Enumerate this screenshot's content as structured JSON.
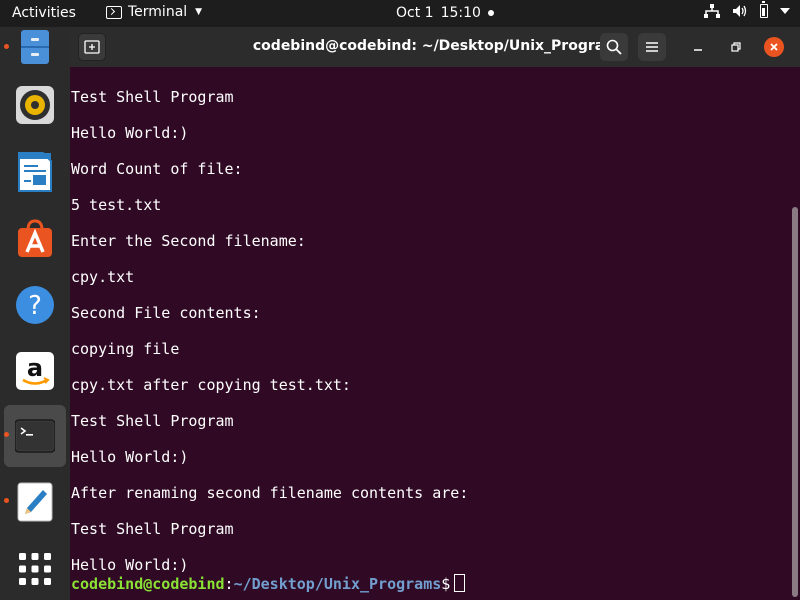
{
  "topbar": {
    "activities": "Activities",
    "app_name": "Terminal",
    "date": "Oct 1",
    "time": "15:10"
  },
  "dock": {
    "items": [
      {
        "name": "files",
        "icon": "file-cabinet-icon",
        "running": true
      },
      {
        "name": "rhythmbox",
        "icon": "speaker-icon",
        "running": false
      },
      {
        "name": "libreoffice-writer",
        "icon": "document-icon",
        "running": false
      },
      {
        "name": "ubuntu-software",
        "icon": "shopping-bag-icon",
        "running": false
      },
      {
        "name": "help",
        "icon": "help-icon",
        "running": false
      },
      {
        "name": "amazon",
        "icon": "amazon-icon",
        "running": false
      },
      {
        "name": "terminal",
        "icon": "terminal-icon",
        "running": true,
        "active": true
      },
      {
        "name": "text-editor",
        "icon": "pencil-icon",
        "running": true
      },
      {
        "name": "show-applications",
        "icon": "grid-icon",
        "running": false
      }
    ]
  },
  "window": {
    "title": "codebind@codebind: ~/Desktop/Unix_Programs"
  },
  "terminal": {
    "lines": [
      "Test Shell Program",
      "Hello World:)",
      "Word Count of file:",
      "5 test.txt",
      "Enter the Second filename:",
      "cpy.txt",
      "Second File contents:",
      "copying file",
      "cpy.txt after copying test.txt:",
      "Test Shell Program",
      "Hello World:)",
      "After renaming second filename contents are:",
      "Test Shell Program",
      "Hello World:)"
    ],
    "prompt": {
      "user_host": "codebind@codebind",
      "separator": ":",
      "path": "~/Desktop/Unix_Programs",
      "symbol": "$"
    }
  },
  "colors": {
    "terminal_bg": "#300a24",
    "prompt_user": "#8ae234",
    "prompt_path": "#729fcf",
    "accent": "#e95420"
  }
}
